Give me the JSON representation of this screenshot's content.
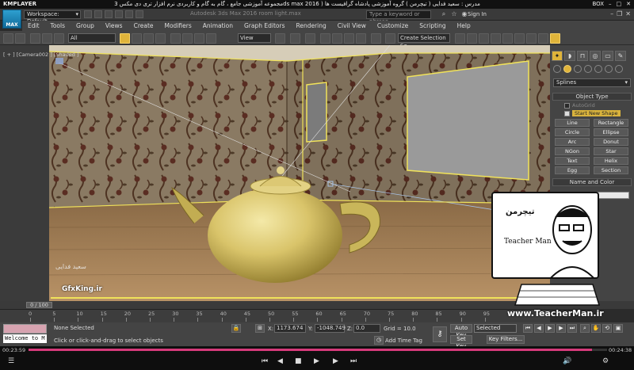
{
  "player": {
    "name": "KMPLAYER",
    "title": "مجموعه آموزشی جامع ، گام به گام و کاربردی نرم افزار تری دی مکس 3ds max 2016 ) مدرس : سعید فدایی ( تیچرمن ) گروه آموزشی پادشاه گرافیست ها",
    "badge": "BOX",
    "time_elapsed": "00:23:59",
    "time_total": "00:24:38",
    "progress": 0.974
  },
  "app": {
    "logo": "MAX",
    "workspace": "Workspace: Default",
    "name": "Autodesk 3ds Max 2016    room light.max",
    "search_placeholder": "Type a keyword or phrase",
    "signin": "Sign In"
  },
  "menu": [
    "Edit",
    "Tools",
    "Group",
    "Views",
    "Create",
    "Modifiers",
    "Animation",
    "Graph Editors",
    "Rendering",
    "Civil View",
    "Customize",
    "Scripting",
    "Help"
  ],
  "toolbar": {
    "filter": "All",
    "ref_coord": "View",
    "selection_set": "Create Selection Se"
  },
  "viewport": {
    "label": "[ + ] [Camera002 ] [Shaded ]"
  },
  "command_panel": {
    "dropdown": "Splines",
    "object_type_header": "Object Type",
    "autogrid": "AutoGrid",
    "start_new_shape": "Start New Shape",
    "buttons": [
      "Line",
      "Rectangle",
      "Circle",
      "Ellipse",
      "Arc",
      "Donut",
      "NGon",
      "Star",
      "Text",
      "Helix",
      "Egg",
      "Section"
    ],
    "name_color_header": "Name and Color"
  },
  "watermark": {
    "brand": "تیچرمن",
    "sub": "Teacher Man",
    "url": "www.TeacherMan.ir",
    "author_sig": "سعید فدایی",
    "site": "GfxKing.ir"
  },
  "timeline": {
    "slider": "0 / 100",
    "ticks": [
      "0",
      "5",
      "10",
      "15",
      "20",
      "25",
      "30",
      "35",
      "40",
      "45",
      "50",
      "55",
      "60",
      "65",
      "70",
      "75",
      "80",
      "85",
      "90",
      "95"
    ]
  },
  "status": {
    "welcome": "Welcome to M",
    "selection": "None Selected",
    "prompt": "Click or click-and-drag to select objects",
    "x_label": "X:",
    "x_value": "1173.674",
    "y_label": "Y:",
    "y_value": "-1048.749",
    "z_label": "Z:",
    "z_value": "0.0",
    "grid": "Grid = 10.0",
    "add_time_tag": "Add Time Tag",
    "auto_key": "Auto Key",
    "set_key": "Set Key",
    "selected_dd": "Selected",
    "key_filters": "Key Filters..."
  }
}
